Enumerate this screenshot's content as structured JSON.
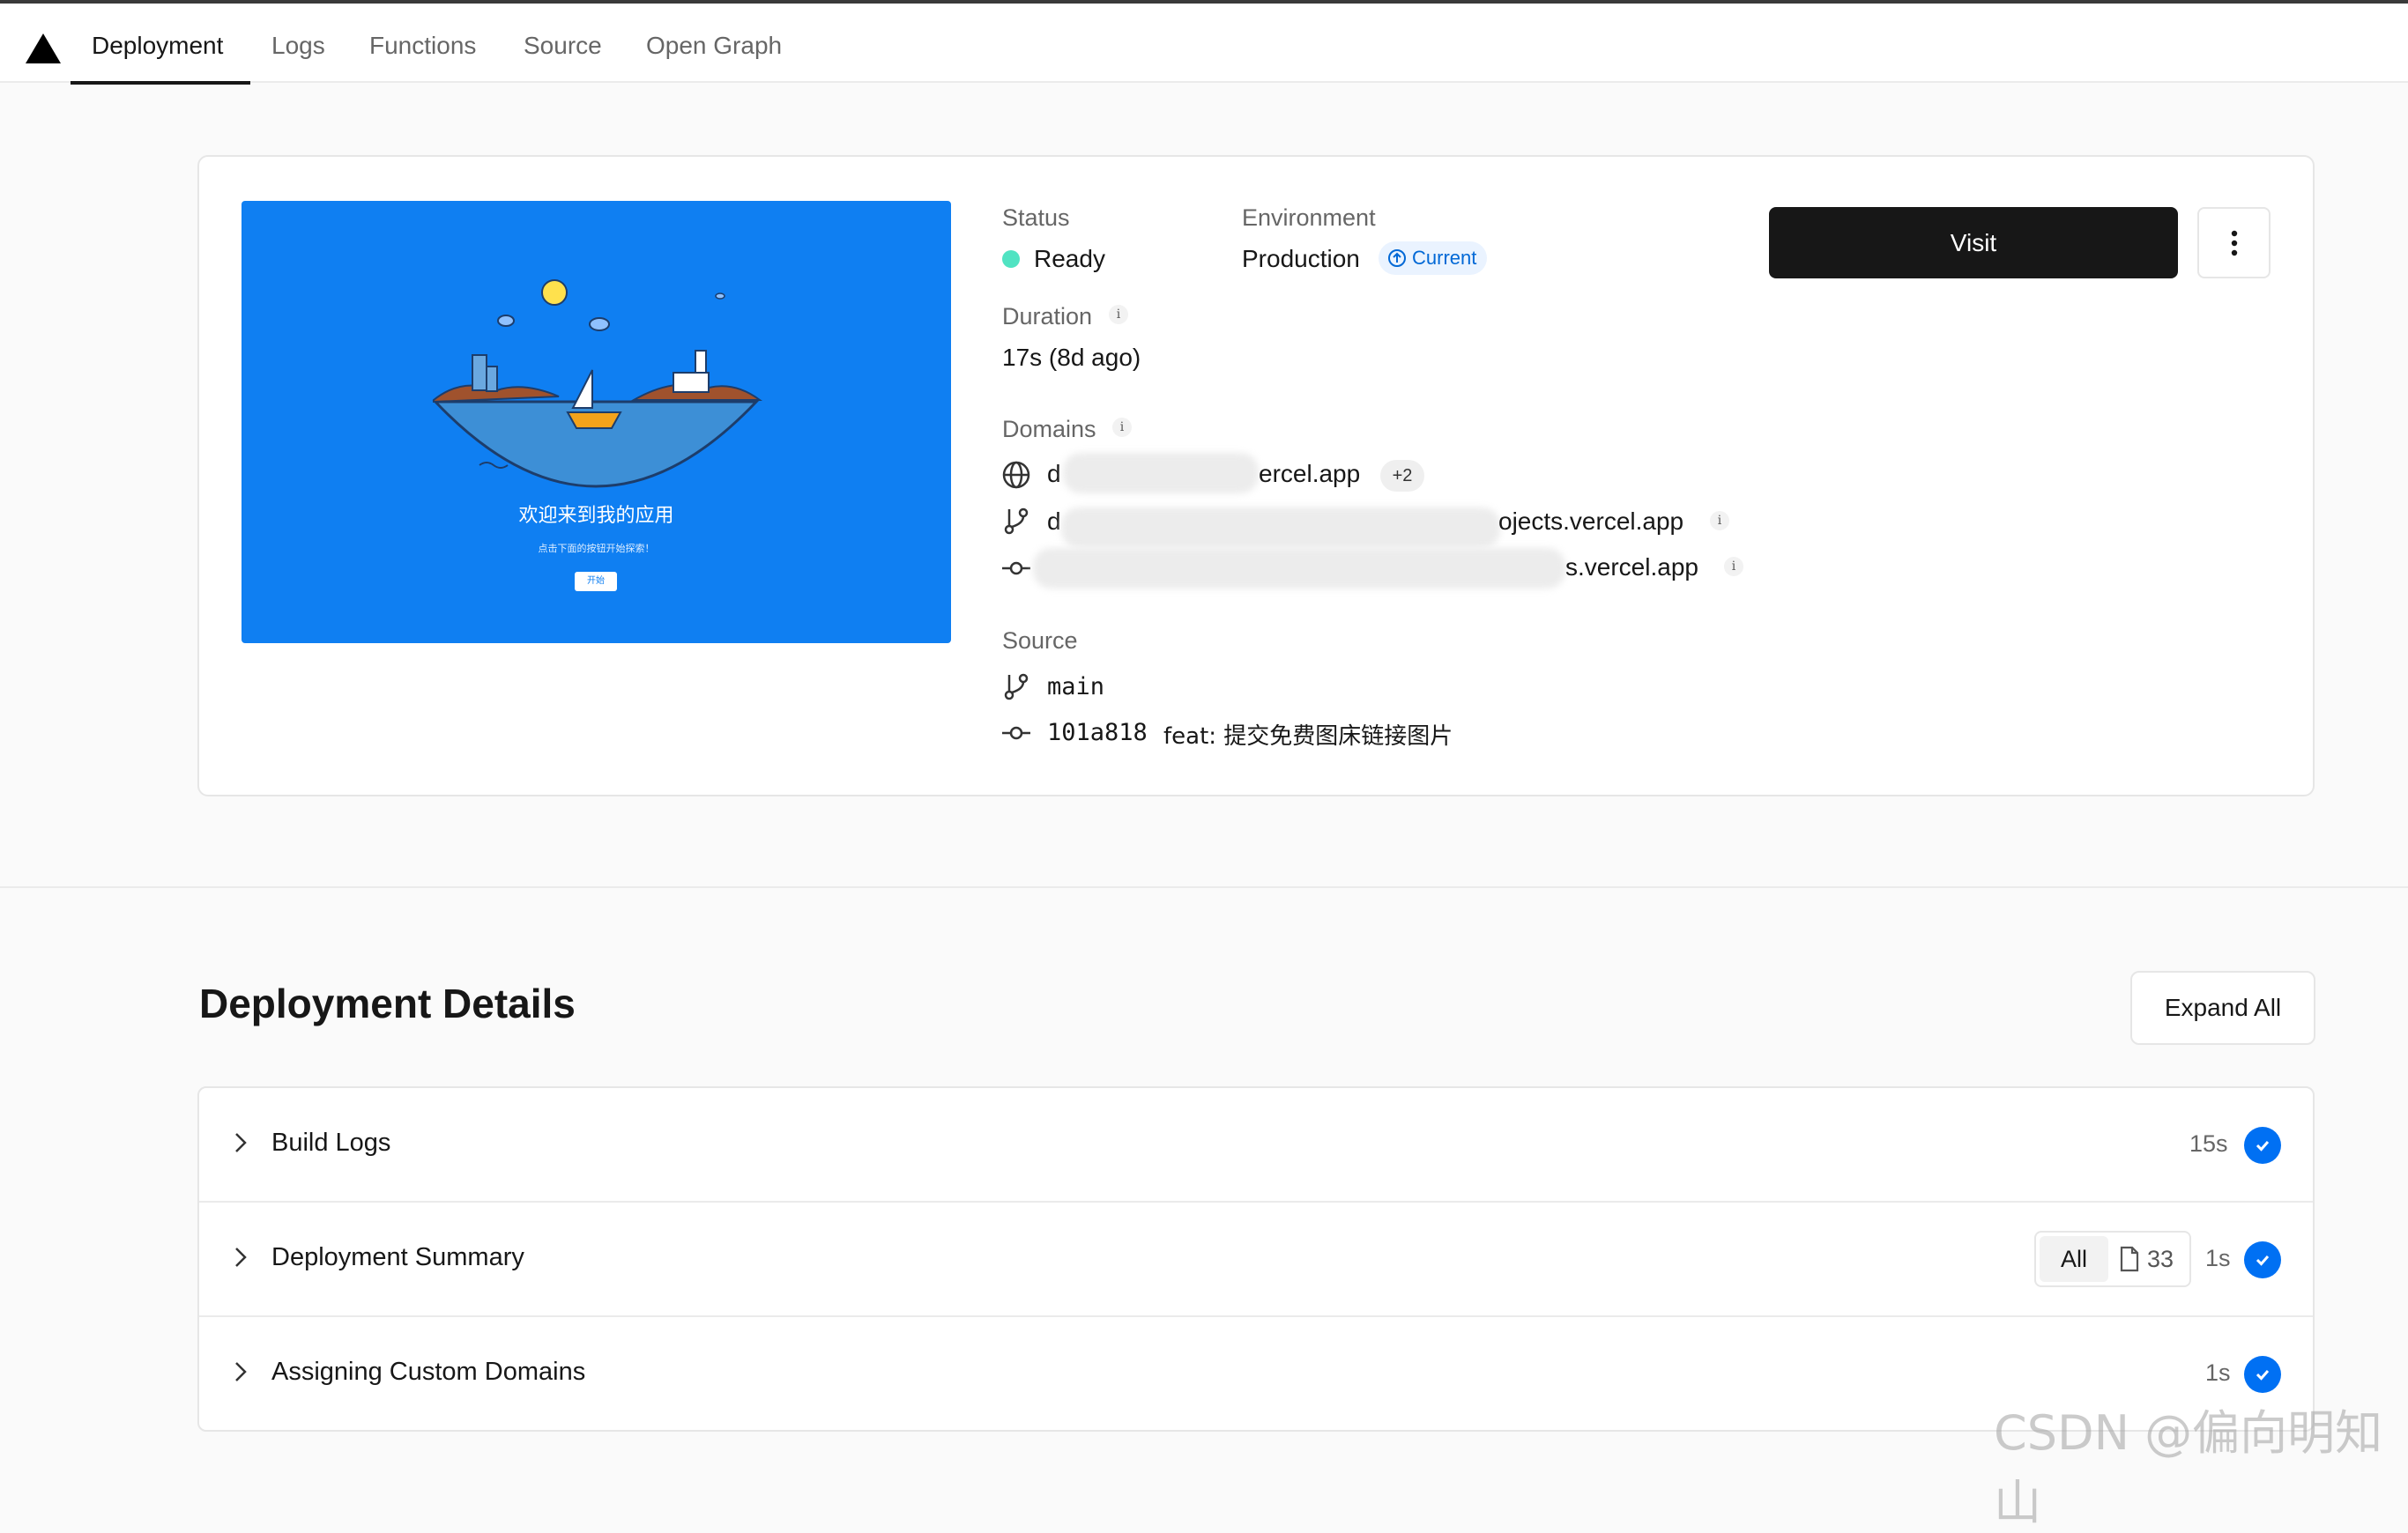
{
  "nav": {
    "tabs": [
      {
        "label": "Deployment",
        "active": true
      },
      {
        "label": "Logs"
      },
      {
        "label": "Functions"
      },
      {
        "label": "Source"
      },
      {
        "label": "Open Graph"
      }
    ]
  },
  "preview": {
    "title": "欢迎来到我的应用",
    "subtitle": "点击下面的按钮开始探索！",
    "button": "开始",
    "background": "#0f7ff2"
  },
  "overview": {
    "status_label": "Status",
    "status_value": "Ready",
    "status_color": "#50e3c2",
    "environment_label": "Environment",
    "environment_value": "Production",
    "current_badge": "Current",
    "duration_label": "Duration",
    "duration_value": "17s (8d ago)",
    "domains_label": "Domains",
    "domains": [
      {
        "icon": "globe-icon",
        "prefix": "d",
        "suffix": "ercel.app",
        "extra": "+2"
      },
      {
        "icon": "git-branch-icon",
        "prefix": "d",
        "suffix": "ojects.vercel.app"
      },
      {
        "icon": "git-commit-icon",
        "prefix": "",
        "suffix": "s.vercel.app"
      }
    ],
    "source_label": "Source",
    "source_branch": "main",
    "source_commit_hash": "101a818",
    "source_commit_message": "feat: 提交免费图床链接图片",
    "info_glyph": "i"
  },
  "actions": {
    "visit": "Visit"
  },
  "details": {
    "title": "Deployment Details",
    "expand_all": "Expand All",
    "rows": [
      {
        "label": "Build Logs",
        "time": "15s"
      },
      {
        "label": "Deployment Summary",
        "time": "1s",
        "filter_all": "All",
        "file_count": "33"
      },
      {
        "label": "Assigning Custom Domains",
        "time": "1s"
      }
    ],
    "check_color": "#0070f3"
  },
  "watermark": "CSDN @偏向明知山"
}
